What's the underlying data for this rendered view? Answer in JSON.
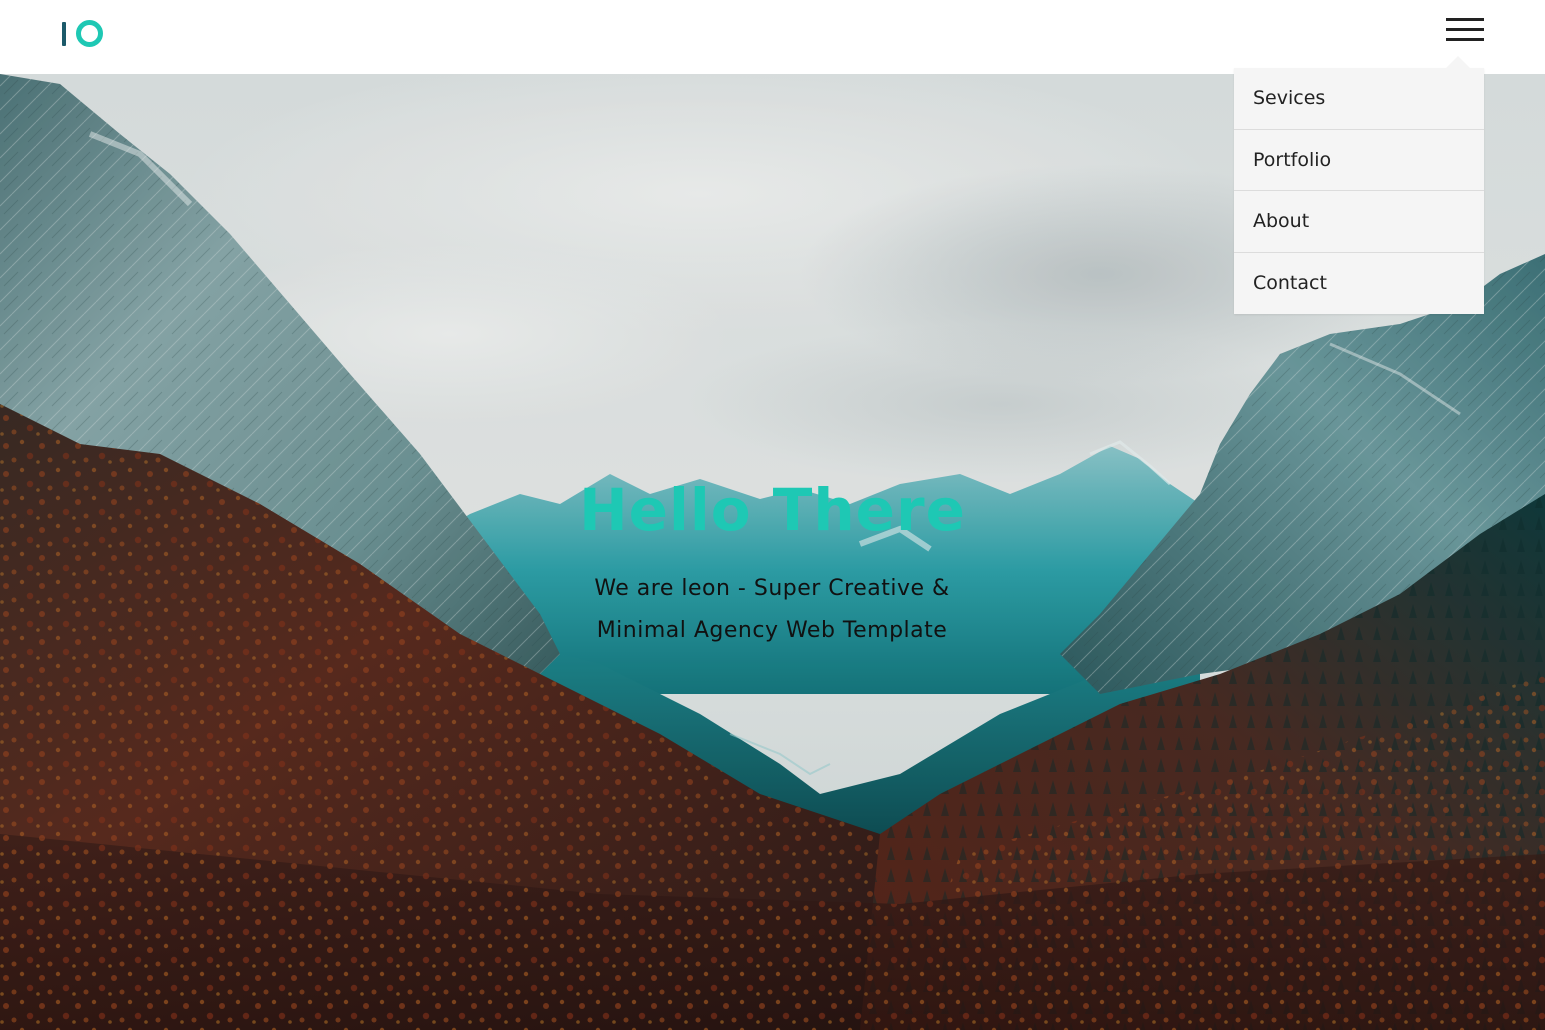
{
  "header": {
    "logo_icon": "io-logo-icon",
    "menu_icon": "hamburger-menu-icon"
  },
  "dropdown": {
    "items": [
      {
        "label": "Sevices"
      },
      {
        "label": "Portfolio"
      },
      {
        "label": "About"
      },
      {
        "label": "Contact"
      }
    ]
  },
  "hero": {
    "title": "Hello There",
    "subtitle": "We are leon - Super Creative & Minimal Agency Web Template",
    "background_image": "mountain-valley-forest-photo"
  },
  "colors": {
    "accent": "#1ec8b4",
    "logo_dark": "#1c5a6a",
    "dropdown_bg": "#f5f5f5",
    "header_bg": "#ffffff",
    "text": "#111111"
  }
}
